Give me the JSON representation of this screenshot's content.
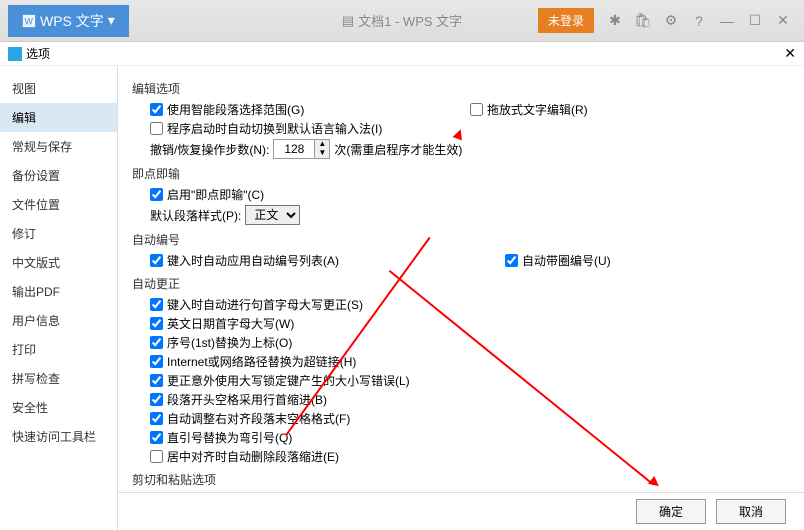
{
  "titlebar": {
    "app_name": "WPS 文字",
    "doc_title": "文档1 - WPS 文字",
    "login": "未登录"
  },
  "dialog": {
    "title": "选项"
  },
  "sidebar": {
    "items": [
      {
        "label": "视图"
      },
      {
        "label": "编辑"
      },
      {
        "label": "常规与保存"
      },
      {
        "label": "备份设置"
      },
      {
        "label": "文件位置"
      },
      {
        "label": "修订"
      },
      {
        "label": "中文版式"
      },
      {
        "label": "输出PDF"
      },
      {
        "label": "用户信息"
      },
      {
        "label": "打印"
      },
      {
        "label": "拼写检查"
      },
      {
        "label": "安全性"
      },
      {
        "label": "快速访问工具栏"
      }
    ]
  },
  "sections": {
    "edit_options": "编辑选项",
    "instant_input": "即点即输",
    "auto_number": "自动编号",
    "auto_correct": "自动更正",
    "cut_paste": "剪切和粘贴选项"
  },
  "options": {
    "smart_para": "使用智能段落选择范围(G)",
    "drag_text": "拖放式文字编辑(R)",
    "default_ime": "程序启动时自动切换到默认语言输入法(I)",
    "undo_label_pre": "撤销/恢复操作步数(N):",
    "undo_value": "128",
    "undo_label_post": "次(需重启程序才能生效)",
    "instant_enable": "启用\"即点即输\"(C)",
    "default_style_label": "默认段落样式(P):",
    "default_style_value": "正文",
    "auto_number_list": "键入时自动应用自动编号列表(A)",
    "circle_number": "自动带圈编号(U)",
    "cap_first": "键入时自动进行句首字母大写更正(S)",
    "english_date": "英文日期首字母大写(W)",
    "ordinal": "序号(1st)替换为上标(O)",
    "internet": "Internet或网络路径替换为超链接(H)",
    "caps_error": "更正意外使用大写锁定键产生的大小写错误(L)",
    "indent_start": "段落开头空格采用行首缩进(B)",
    "adjust_space": "自动调整右对齐段落末空格格式(F)",
    "quote_replace": "直引号替换为弯引号(Q)",
    "center_indent": "居中对齐时自动删除段落缩进(E)"
  },
  "buttons": {
    "ok": "确定",
    "cancel": "取消"
  }
}
